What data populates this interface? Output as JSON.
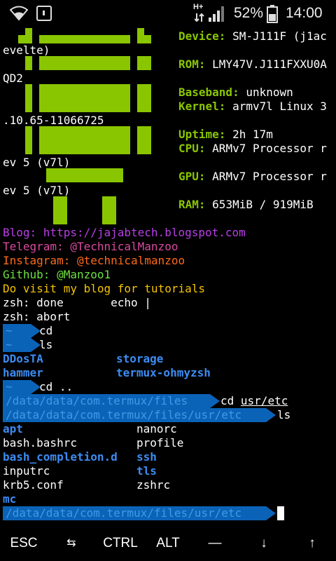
{
  "status_bar": {
    "battery": "52%",
    "time": "14:00",
    "network_type": "H+",
    "icons": [
      "wifi-icon",
      "notification-icon",
      "data-arrows-icon",
      "signal-icon",
      "battery-icon"
    ]
  },
  "sysinfo": {
    "device_label": "Device:",
    "device_value": "SM-J111F (j1ac",
    "device_wrap": "evelte)",
    "rom_label": "ROM:",
    "rom_value": "LMY47V.J111FXXU0A",
    "rom_wrap": "QD2",
    "baseband_label": "Baseband:",
    "baseband_value": "unknown",
    "kernel_label": "Kernel:",
    "kernel_value": "armv7l Linux 3",
    "kernel_wrap": ".10.65-11066725",
    "uptime_label": "Uptime:",
    "uptime_value": "2h 17m",
    "cpu_label": "CPU:",
    "cpu_value": "ARMv7 Processor r",
    "cpu_wrap": "ev 5 (v7l)",
    "gpu_label": "GPU:",
    "gpu_value": "ARMv7 Processor r",
    "gpu_wrap": "ev 5 (v7l)",
    "ram_label": "RAM:",
    "ram_value": "653MiB / 919MiB"
  },
  "links": {
    "blog": "Blog: https://jajabtech.blogspot.com",
    "telegram": "Telegram: @TechnicalManzoo",
    "instagram": "Instagram: @technicalmanzoo",
    "github": "Github: @Manzoo1",
    "visit": "Do visit my blog for tutorials"
  },
  "output": {
    "zsh_done": "zsh: done       echo |",
    "zsh_abort": "zsh: abort"
  },
  "prompts": {
    "home_symbol": "~",
    "cmd_cd": "cd",
    "cmd_ls": "ls",
    "cmd_cd_up": "cd ..",
    "files_path": "/data/data/com.termux/files",
    "cmd_cd_usr": "cd ",
    "cmd_cd_usr_arg": "usr/etc",
    "etc_path": "/data/data/com.termux/files/usr/etc",
    "cmd_ls2": "ls"
  },
  "listing_home": {
    "col1": [
      "DDosTA",
      "hammer"
    ],
    "col2": [
      "storage",
      "termux-ohmyzsh"
    ]
  },
  "listing_etc": [
    {
      "name": "apt",
      "dir": true
    },
    {
      "name": "nanorc",
      "dir": false
    },
    {
      "name": "bash.bashrc",
      "dir": false
    },
    {
      "name": "profile",
      "dir": false
    },
    {
      "name": "bash_completion.d",
      "dir": true
    },
    {
      "name": "ssh",
      "dir": true
    },
    {
      "name": "inputrc",
      "dir": false
    },
    {
      "name": "tls",
      "dir": true
    },
    {
      "name": "krb5.conf",
      "dir": false
    },
    {
      "name": "zshrc",
      "dir": false
    },
    {
      "name": "mc",
      "dir": true
    }
  ],
  "extra_keys": {
    "esc": "ESC",
    "tab": "⇆",
    "ctrl": "CTRL",
    "alt": "ALT",
    "dash": "—",
    "down": "↓",
    "up": "↑"
  },
  "colors": {
    "logo_green": "#8ac600",
    "prompt_blue": "#0b63b8",
    "dir_blue": "#3c8cf2"
  }
}
